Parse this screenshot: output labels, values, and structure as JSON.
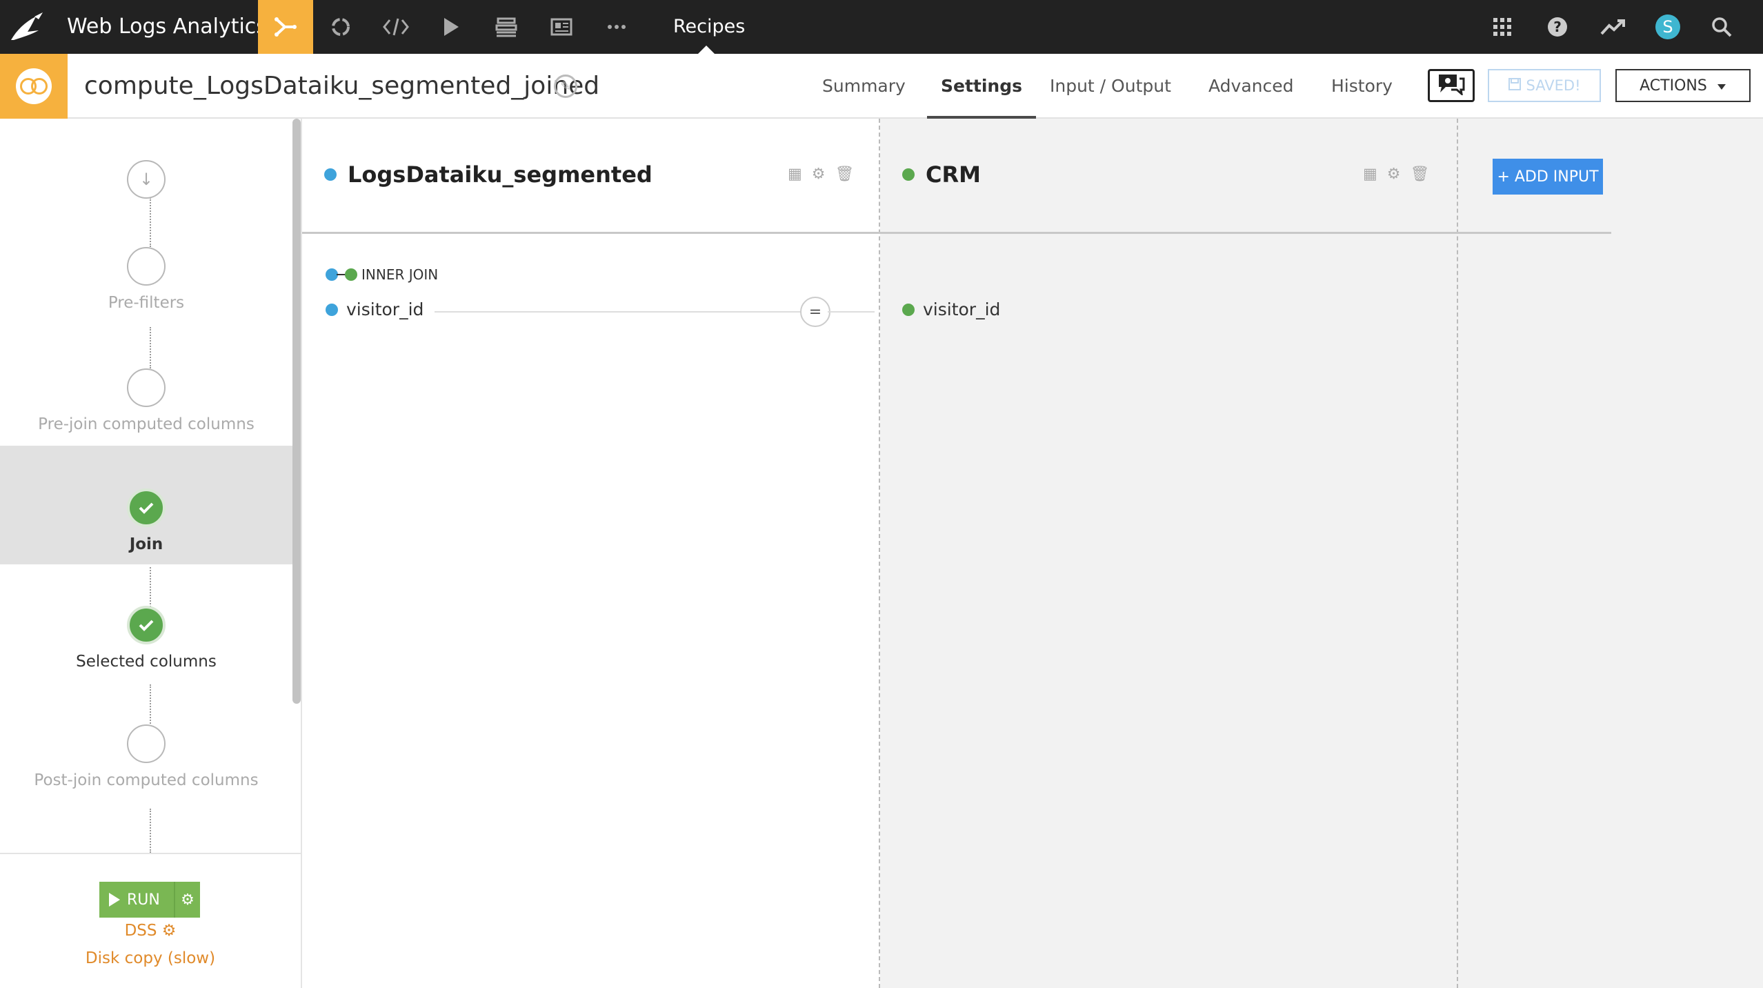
{
  "topnav": {
    "project_name": "Web Logs Analytics",
    "current_section": "Recipes",
    "avatar_letter": "S",
    "icons": [
      "dataiku-bird-logo",
      "flow-icon",
      "recycle-icon",
      "code-icon",
      "play-icon",
      "stack-icon",
      "dashboard-icon",
      "more-icon",
      "apps-grid-icon",
      "help-icon",
      "trend-icon",
      "search-icon"
    ]
  },
  "header": {
    "recipe_title": "compute_LogsDataiku_segmented_joined",
    "tabs": [
      "Summary",
      "Settings",
      "Input / Output",
      "Advanced",
      "History"
    ],
    "active_tab": "Settings",
    "saved_label": "SAVED!",
    "actions_label": "ACTIONS"
  },
  "sidebar": {
    "steps": [
      {
        "label": ""
      },
      {
        "label": "Pre-filters"
      },
      {
        "label": "Pre-join computed columns"
      },
      {
        "label": "Join"
      },
      {
        "label": "Selected columns"
      },
      {
        "label": "Post-join computed columns"
      }
    ],
    "run_label": "RUN",
    "engine": "DSS",
    "engine_detail": "Disk copy (slow)"
  },
  "main": {
    "left_dataset": "LogsDataiku_segmented",
    "right_dataset": "CRM",
    "add_input_label": "+ ADD INPUT",
    "join_type": "INNER JOIN",
    "condition": {
      "left_column": "visitor_id",
      "operator": "=",
      "right_column": "visitor_id"
    }
  },
  "colors": {
    "accent": "#f6b13e",
    "left_dataset_dot": "#3ea3db",
    "right_dataset_dot": "#5ba84e",
    "run_button": "#7ab753",
    "add_input_button": "#3f8fe8"
  }
}
